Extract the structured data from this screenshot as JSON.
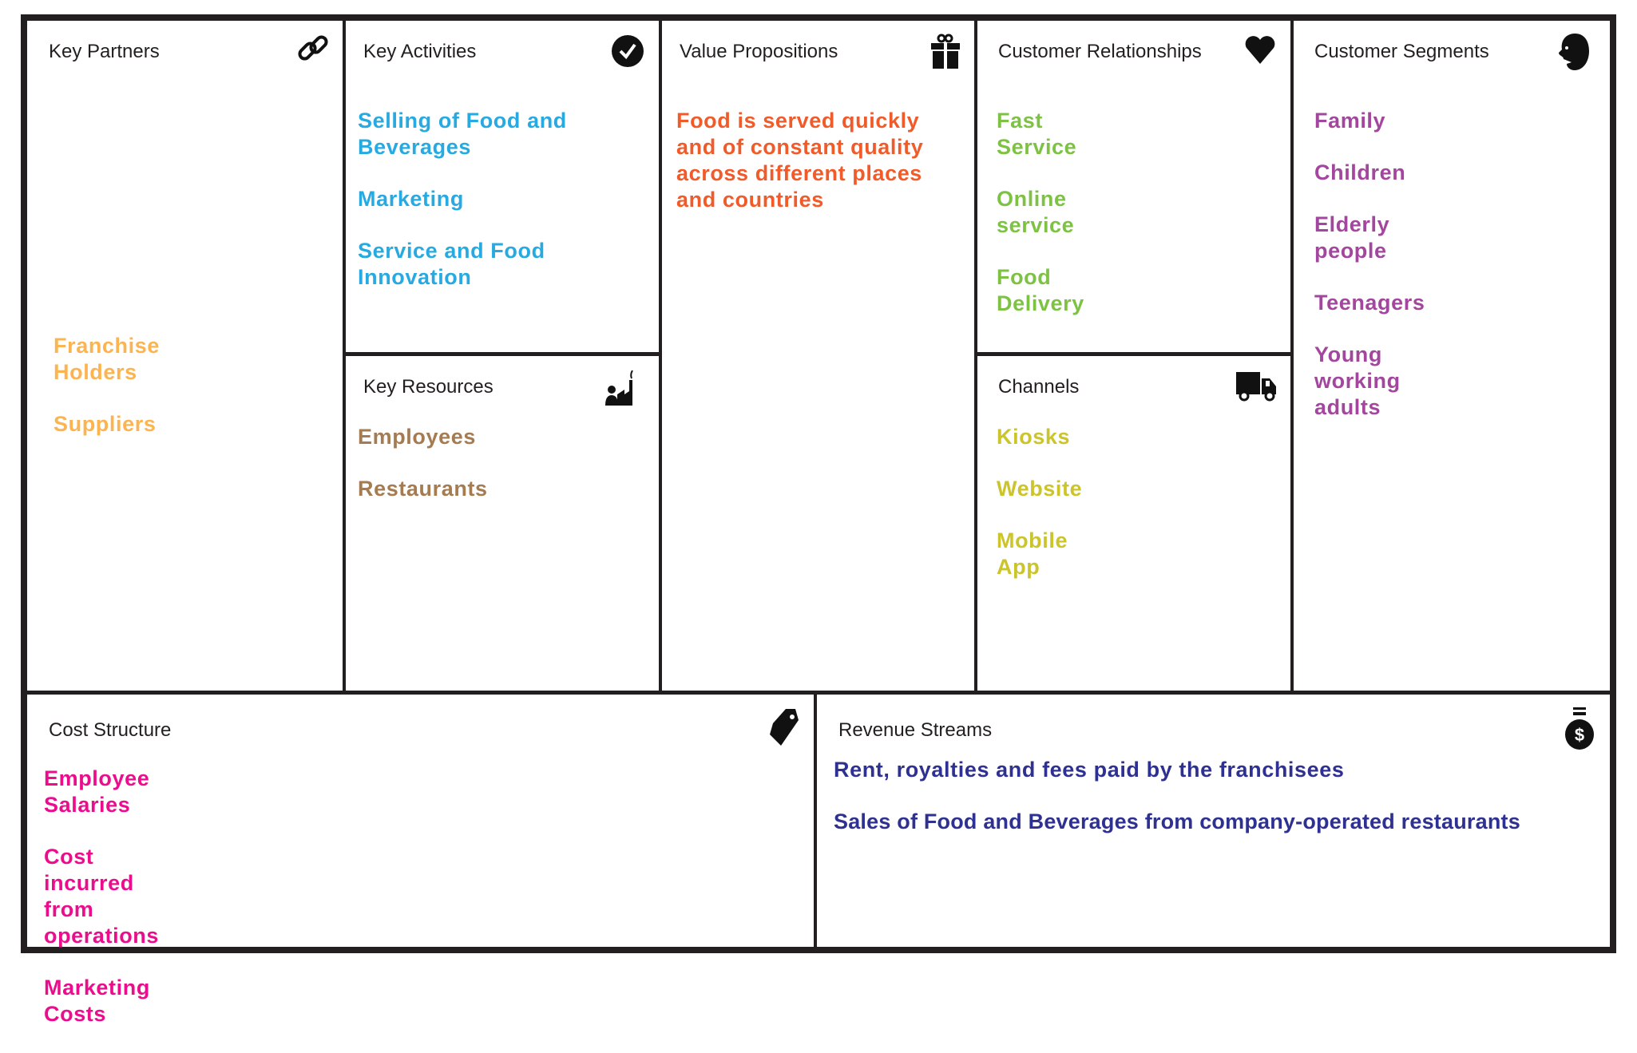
{
  "canvas": {
    "key_partners": {
      "title": "Key Partners",
      "icon": "link-icon",
      "color": "#fbb450",
      "items": [
        "Franchise Holders",
        "Suppliers"
      ]
    },
    "key_activities": {
      "title": "Key Activities",
      "icon": "check-circle-icon",
      "color": "#27aae1",
      "items": [
        "Selling of Food and Beverages",
        "Marketing",
        "Service and Food Innovation"
      ]
    },
    "key_resources": {
      "title": "Key Resources",
      "icon": "factory-worker-icon",
      "color": "#a57c52",
      "items": [
        "Employees",
        "Restaurants"
      ]
    },
    "value_propositions": {
      "title": "Value Propositions",
      "icon": "gift-icon",
      "color": "#f15a29",
      "items": [
        "Food is served quickly and of constant quality across different places and countries"
      ]
    },
    "customer_relationships": {
      "title": "Customer Relationships",
      "icon": "heart-icon",
      "color": "#7dc242",
      "items": [
        "Fast Service",
        "Online service",
        "Food Delivery"
      ]
    },
    "channels": {
      "title": "Channels",
      "icon": "truck-icon",
      "color": "#cbc42b",
      "items": [
        "Kiosks",
        "Website",
        "Mobile App"
      ]
    },
    "customer_segments": {
      "title": "Customer Segments",
      "icon": "face-icon",
      "color": "#a3479e",
      "items": [
        "Family",
        "Children",
        "Elderly people",
        "Teenagers",
        "Young working adults"
      ]
    },
    "cost_structure": {
      "title": "Cost Structure",
      "icon": "price-tag-icon",
      "color": "#ec0d8c",
      "items": [
        "Employee Salaries",
        "Cost incurred from operations",
        "Marketing Costs"
      ]
    },
    "revenue_streams": {
      "title": "Revenue Streams",
      "icon": "money-bag-icon",
      "color": "#2e3192",
      "items": [
        "Rent, royalties and fees paid by the franchisees",
        "Sales of Food and Beverages from company-operated restaurants"
      ]
    }
  }
}
